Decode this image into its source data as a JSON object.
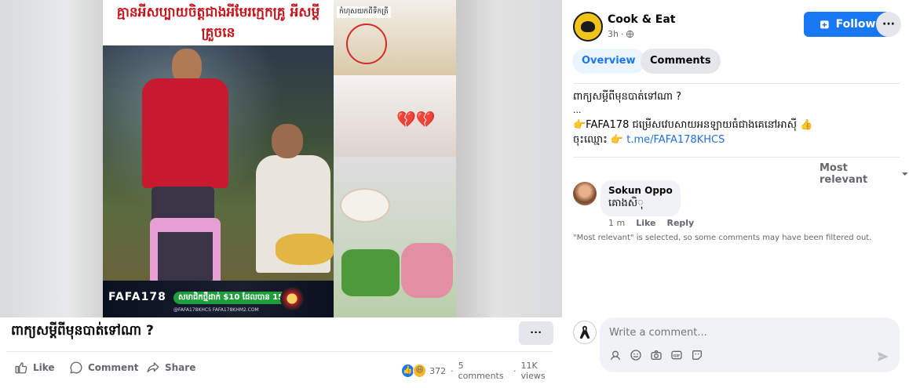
{
  "video": {
    "overlay_title": "គ្មានអីសប្បាយចិត្តជាងអីមែរក្មេកគ្រូ អីសម្តីគ្រួចនេ",
    "side_label": "កំហុសយកពីទឹកត្រី",
    "banner": {
      "brand": "FAFA178",
      "promo": "សមាជិកថ្មីដាក់ $10 ដែលបាន 15$",
      "links": "@FAFA178KHCS   FAFA178KHM2.COM"
    }
  },
  "post": {
    "title": "ពាក្យសម្តីពីមុនបាត់ទៅណា ?",
    "more_label": "···",
    "actions": {
      "like": "Like",
      "comment": "Comment",
      "share": "Share"
    },
    "stats": {
      "reactions": "372",
      "comments": "5 comments",
      "views": "11K views"
    }
  },
  "page": {
    "name": "Cook & Eat",
    "time": "3h",
    "follow_label": "Follow",
    "menu_label": "···"
  },
  "tabs": {
    "overview": "Overview",
    "comments": "Comments"
  },
  "body": {
    "line1": "ពាក្យសម្តីពីមុនបាត់ទៅណា ?",
    "line2": "...",
    "line3": "👉FAFA178 ជម្រើសវេបសាយអនឡាយធំជាងគេនៅអាស៊ី 👍",
    "line4_prefix": "ចុះឈ្មោះ 👉 ",
    "line4_link": "t.me/FAFA178KHCS"
  },
  "comments": {
    "sort_label": "Most relevant",
    "items": [
      {
        "name": "Sokun Oppo",
        "text": "គោងសិុ",
        "time": "1 m",
        "like": "Like",
        "reply": "Reply"
      }
    ],
    "filter_note": "\"Most relevant\" is selected, so some comments may have been filtered out."
  },
  "composer": {
    "placeholder": "Write a comment..."
  },
  "colors": {
    "accent": "#1877f2",
    "tab_active_bg": "#ebf5ff",
    "button_gray": "#e4e6eb",
    "overlay_red": "#c4161c"
  }
}
